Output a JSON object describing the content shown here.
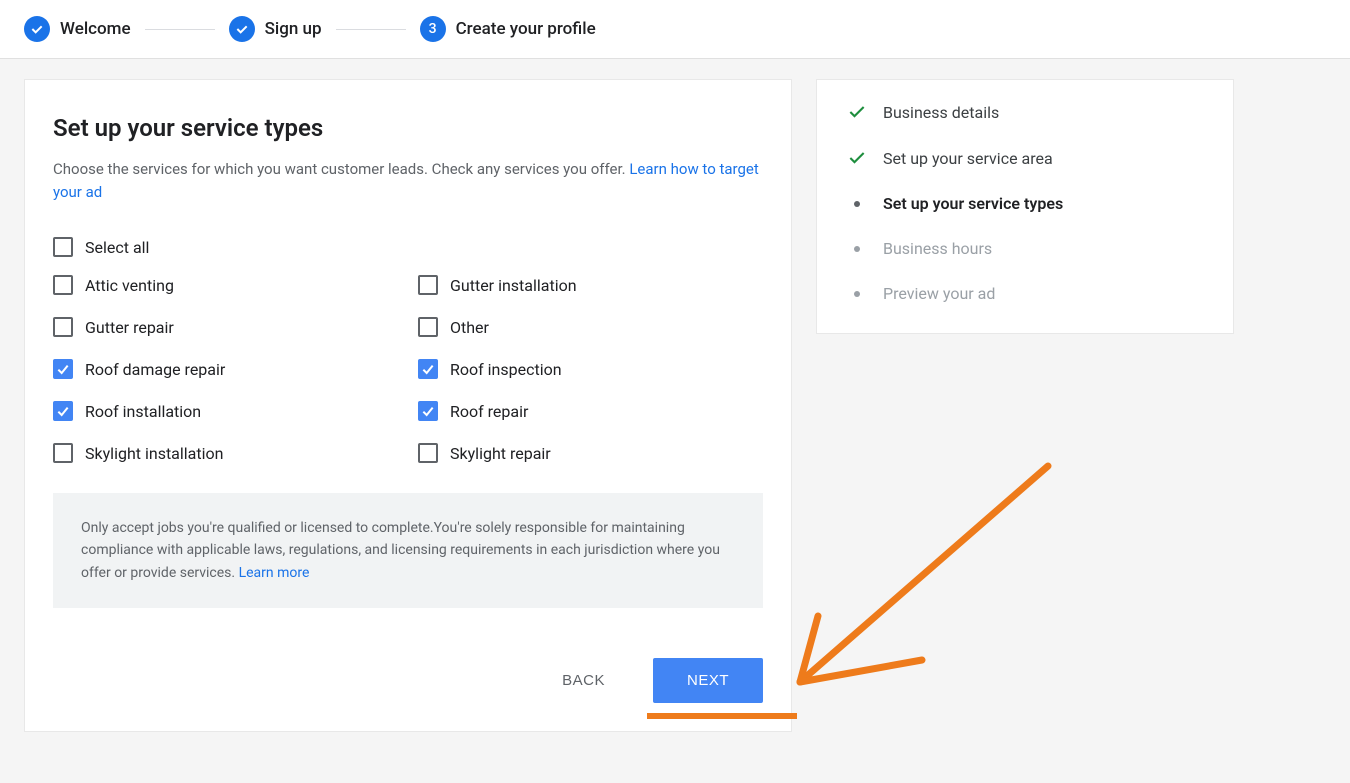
{
  "stepper": {
    "steps": [
      {
        "label": "Welcome",
        "done": true
      },
      {
        "label": "Sign up",
        "done": true
      },
      {
        "label": "Create your profile",
        "number": "3",
        "done": false
      }
    ]
  },
  "main": {
    "title": "Set up your service types",
    "description_prefix": "Choose the services for which you want customer leads. Check any services you offer. ",
    "description_link": "Learn how to target your ad",
    "select_all_label": "Select all",
    "services": [
      {
        "label": "Attic venting",
        "checked": false
      },
      {
        "label": "Gutter installation",
        "checked": false
      },
      {
        "label": "Gutter repair",
        "checked": false
      },
      {
        "label": "Other",
        "checked": false
      },
      {
        "label": "Roof damage repair",
        "checked": true
      },
      {
        "label": "Roof inspection",
        "checked": true
      },
      {
        "label": "Roof installation",
        "checked": true
      },
      {
        "label": "Roof repair",
        "checked": true
      },
      {
        "label": "Skylight installation",
        "checked": false
      },
      {
        "label": "Skylight repair",
        "checked": false
      }
    ],
    "disclaimer_text": "Only accept jobs you're qualified or licensed to complete.You're solely responsible for maintaining compliance with applicable laws, regulations, and licensing requirements in each jurisdiction where you offer or provide services. ",
    "disclaimer_link": "Learn more",
    "back_label": "BACK",
    "next_label": "NEXT"
  },
  "sidebar": {
    "items": [
      {
        "label": "Business details",
        "state": "done"
      },
      {
        "label": "Set up your service area",
        "state": "done"
      },
      {
        "label": "Set up your service types",
        "state": "active"
      },
      {
        "label": "Business hours",
        "state": "pending"
      },
      {
        "label": "Preview your ad",
        "state": "pending"
      }
    ]
  },
  "colors": {
    "primary": "#1a73e8",
    "button": "#4285f4",
    "annotation": "#ee7b1b",
    "check_green": "#1e8e3e"
  }
}
